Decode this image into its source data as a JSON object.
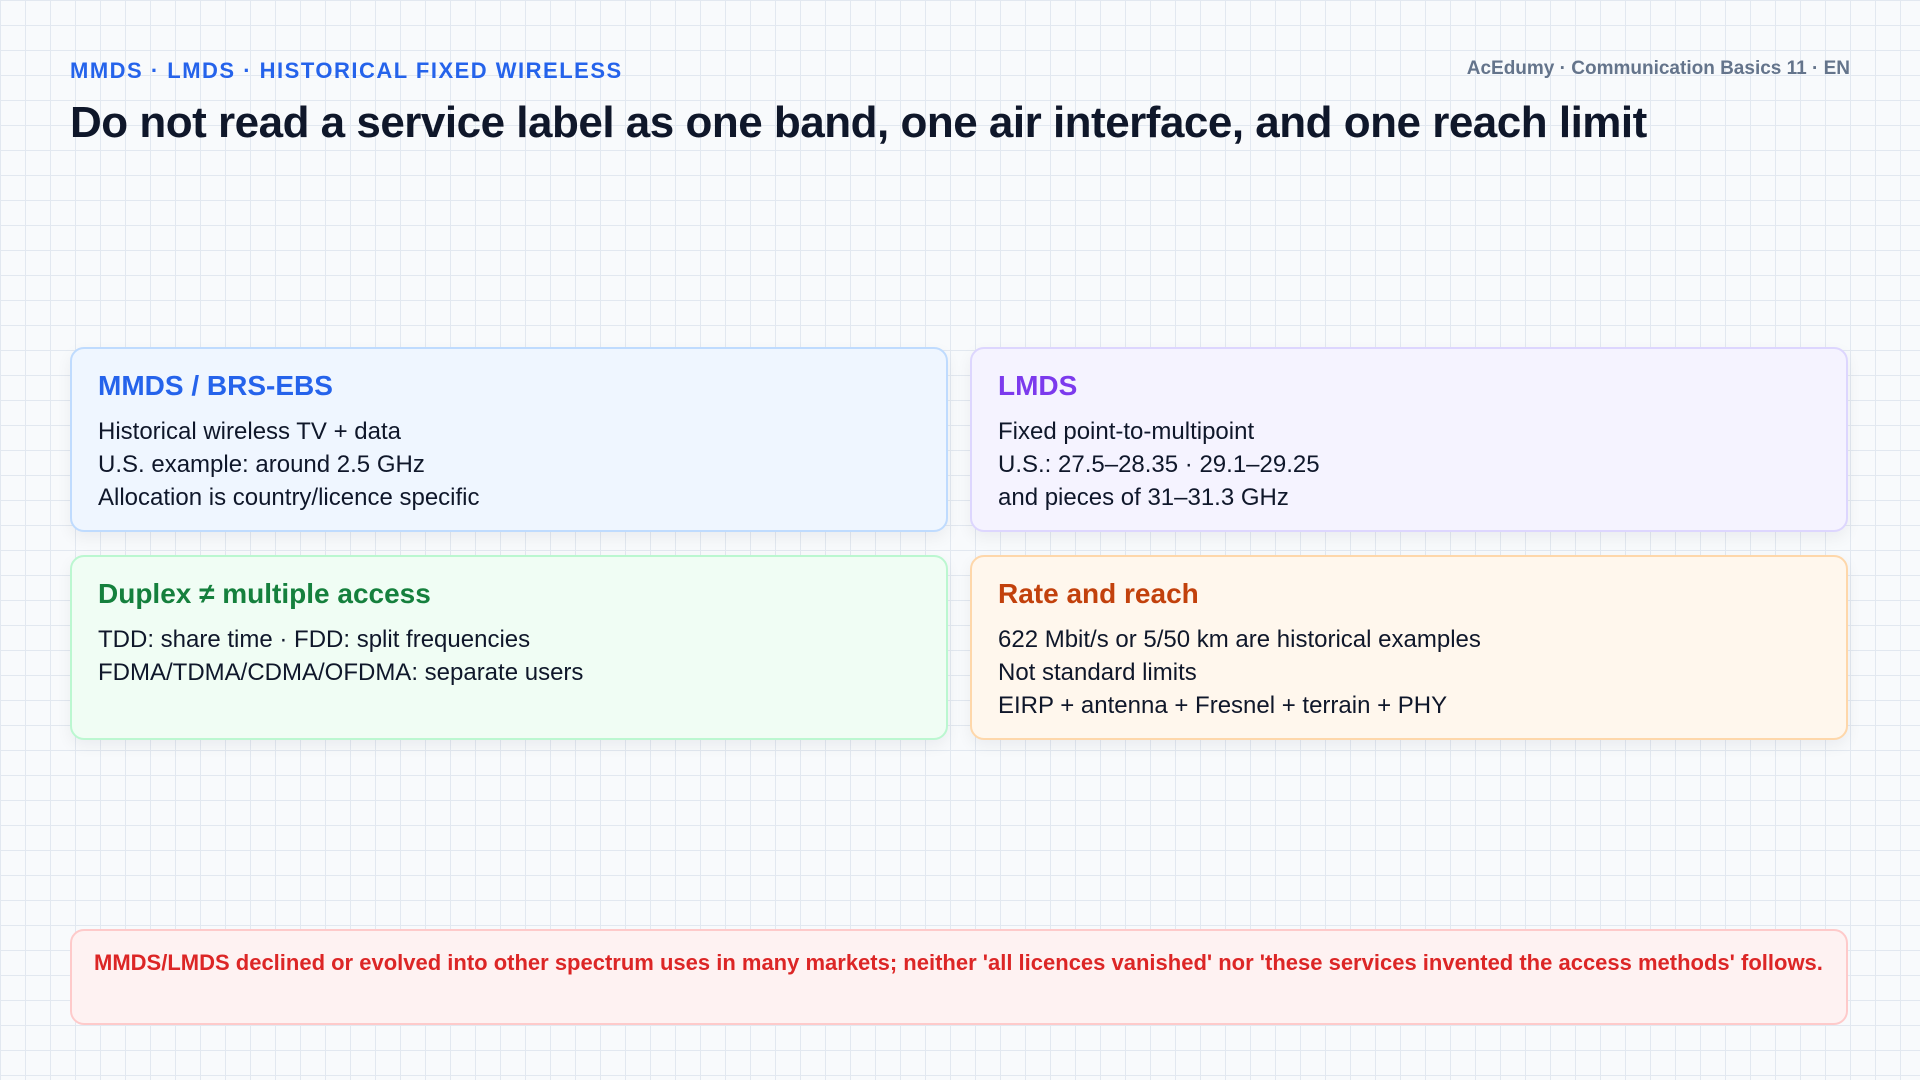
{
  "header": {
    "eyebrow": "MMDS · LMDS · HISTORICAL FIXED WIRELESS",
    "meta": "AcEdumy · Communication Basics 11 · EN",
    "title": "Do not read a service label as one band, one air interface, and one reach limit"
  },
  "cards": [
    {
      "title": "MMDS / BRS-EBS",
      "lines": [
        "Historical wireless TV + data",
        "U.S. example: around 2.5 GHz",
        "Allocation is country/licence specific"
      ]
    },
    {
      "title": "LMDS",
      "lines": [
        "Fixed point-to-multipoint",
        "U.S.: 27.5–28.35 · 29.1–29.25",
        "and pieces of 31–31.3 GHz"
      ]
    },
    {
      "title": "Duplex ≠ multiple access",
      "lines": [
        "TDD: share time · FDD: split frequencies",
        "FDMA/TDMA/CDMA/OFDMA: separate users"
      ]
    },
    {
      "title": "Rate and reach",
      "lines": [
        "622 Mbit/s or 5/50 km are historical examples",
        "Not standard limits",
        "EIRP + antenna + Fresnel + terrain + PHY"
      ]
    }
  ],
  "note": "MMDS/LMDS declined or evolved into other spectrum uses in many markets; neither 'all licences vanished' nor 'these services invented the access methods' follows.",
  "colors": {
    "accent": "#2563eb",
    "mmds": "#2563eb",
    "lmds": "#7c3aed",
    "duplex": "#15803d",
    "rate": "#c2410c",
    "warning": "#dc2626"
  }
}
